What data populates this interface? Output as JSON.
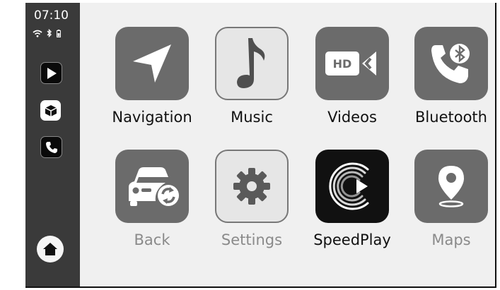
{
  "status": {
    "time": "07:10"
  },
  "sidebar": {
    "apps": [
      "play-app",
      "box-app",
      "phone-app"
    ]
  },
  "apps": [
    {
      "label": "Navigation",
      "icon": "navigation-arrow-icon"
    },
    {
      "label": "Music",
      "icon": "music-note-icon"
    },
    {
      "label": "Videos",
      "icon": "hd-video-camera-icon",
      "badge": "HD"
    },
    {
      "label": "Bluetooth",
      "icon": "bluetooth-phone-icon"
    },
    {
      "label": "Back",
      "icon": "car-refresh-icon"
    },
    {
      "label": "Settings",
      "icon": "gear-icon"
    },
    {
      "label": "SpeedPlay",
      "icon": "speedplay-logo-icon"
    },
    {
      "label": "Maps",
      "icon": "map-pin-icon"
    }
  ],
  "colors": {
    "sidebar": "#3a3a3a",
    "background": "#f0f0f0",
    "tile_dark": "#6b6b6b",
    "tile_light": "#e6e6e6"
  }
}
